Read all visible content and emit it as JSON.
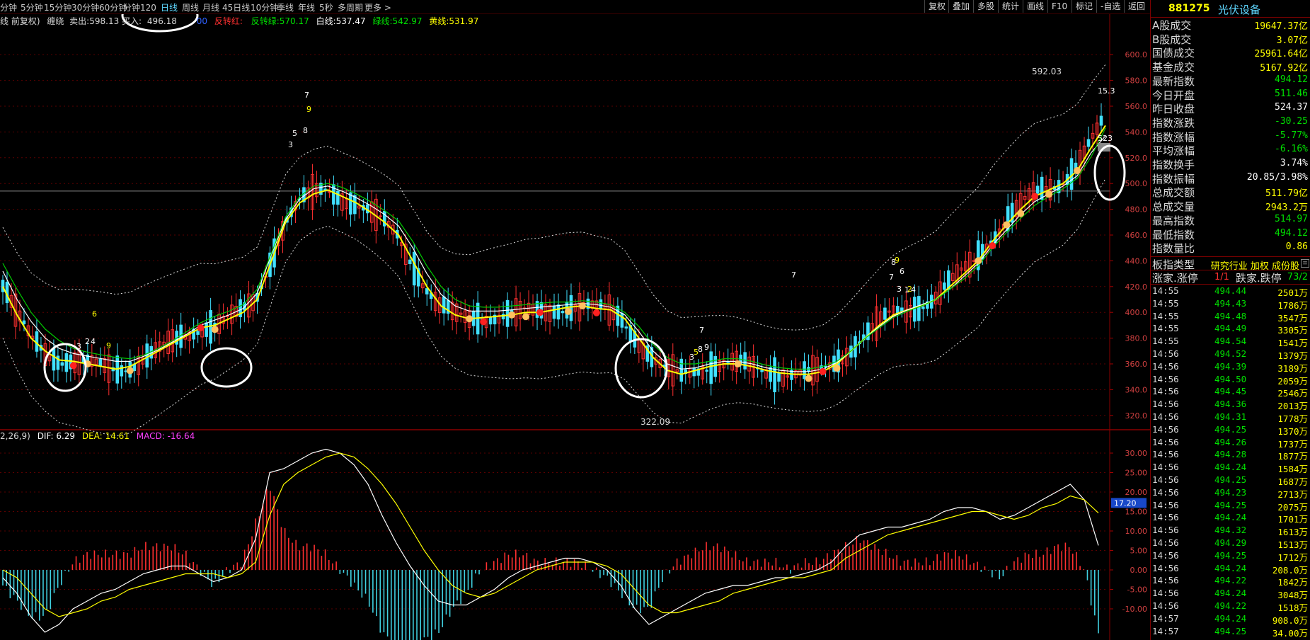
{
  "topbar": {
    "periods": [
      "分钟",
      "5分钟",
      "15分钟",
      "30分钟",
      "60分钟",
      "分钟120",
      "日线",
      "周线",
      "月线",
      "45日线",
      "10分钟",
      "季线",
      "年线",
      "5秒",
      "多周期",
      "更多 >"
    ],
    "active_period": "日线",
    "buttons": [
      "复权",
      "叠加",
      "多股",
      "统计",
      "画线",
      "F10",
      "标记",
      "-自选",
      "返回"
    ]
  },
  "legend": {
    "prefix": "线 前复权)",
    "item1": "缠绕",
    "sell_label": "卖出:",
    "sell_value": "598.13",
    "buy_label": "买入:",
    "buy_value": "496.18",
    "mid_value": "00",
    "red_label": "反转红:",
    "green_label": "反转绿:",
    "green_value": "570.17",
    "white_label": "白线:",
    "white_value": "537.47",
    "gline_label": "绿线:",
    "gline_value": "542.97",
    "yline_label": "黄线:",
    "yline_value": "531.97"
  },
  "macd_legend": {
    "params": "2,26,9)",
    "dif_label": "DIF:",
    "dif_value": "6.29",
    "dea_label": "DEA:",
    "dea_value": "14.61",
    "macd_label": "MACD:",
    "macd_value": "-16.64"
  },
  "annotations": {
    "high_label": "592.03",
    "low_label": "322.09",
    "current_tag": "523",
    "right_tag": "15.3",
    "macd_current": "17.20",
    "counts": [
      "7",
      "9",
      "3",
      "5",
      "8",
      "6",
      "2",
      "4",
      "3",
      "9",
      "7",
      "9",
      "3",
      "5",
      "8",
      "7",
      "8",
      "9",
      "6",
      "1",
      "3",
      "2",
      "4",
      "7"
    ]
  },
  "chart_data": [
    {
      "type": "line",
      "title": "",
      "ylim": [
        310,
        610
      ],
      "y_ticks": [
        "600.0",
        "580.0",
        "560.0",
        "540.0",
        "520.0",
        "500.0",
        "480.0",
        "460.0",
        "440.0",
        "420.0",
        "400.0",
        "380.0",
        "360.0",
        "340.0",
        "320.0"
      ],
      "series": [
        {
          "name": "黄线",
          "color": "#ffff00",
          "values": [
            420,
            398,
            380,
            370,
            363,
            362,
            360,
            358,
            356,
            358,
            364,
            370,
            376,
            382,
            388,
            390,
            395,
            400,
            410,
            440,
            470,
            485,
            492,
            495,
            490,
            485,
            478,
            470,
            460,
            440,
            420,
            405,
            398,
            395,
            396,
            397,
            398,
            400,
            400,
            402,
            404,
            405,
            403,
            402,
            395,
            380,
            365,
            355,
            352,
            355,
            358,
            360,
            360,
            358,
            355,
            353,
            352,
            352,
            354,
            360,
            370,
            380,
            390,
            398,
            402,
            405,
            410,
            420,
            430,
            440,
            455,
            468,
            480,
            490,
            495,
            500,
            510,
            528,
            545
          ]
        },
        {
          "name": "白线",
          "color": "#ffffff",
          "values": [
            432,
            410,
            393,
            380,
            372,
            368,
            366,
            364,
            362,
            362,
            366,
            371,
            377,
            383,
            390,
            394,
            398,
            403,
            415,
            445,
            472,
            488,
            496,
            498,
            494,
            489,
            483,
            476,
            467,
            450,
            430,
            414,
            405,
            401,
            401,
            401,
            402,
            403,
            404,
            405,
            406,
            407,
            406,
            404,
            398,
            385,
            370,
            360,
            356,
            357,
            360,
            362,
            362,
            360,
            357,
            355,
            354,
            354,
            356,
            361,
            370,
            380,
            389,
            397,
            402,
            406,
            410,
            418,
            428,
            438,
            452,
            464,
            476,
            486,
            492,
            498,
            506,
            524,
            537
          ]
        },
        {
          "name": "绿线",
          "color": "#00cc00",
          "values": [
            438,
            418,
            400,
            387,
            378,
            372,
            369,
            367,
            365,
            364,
            367,
            372,
            378,
            385,
            392,
            397,
            401,
            406,
            418,
            446,
            474,
            490,
            498,
            500,
            497,
            492,
            486,
            479,
            471,
            455,
            436,
            420,
            410,
            405,
            404,
            404,
            405,
            406,
            407,
            408,
            408,
            409,
            408,
            406,
            400,
            389,
            375,
            365,
            360,
            360,
            362,
            364,
            364,
            362,
            359,
            357,
            356,
            356,
            358,
            362,
            370,
            380,
            388,
            396,
            401,
            405,
            410,
            418,
            426,
            436,
            450,
            462,
            473,
            483,
            490,
            496,
            504,
            521,
            543
          ]
        }
      ],
      "price_range": {
        "high": 592.03,
        "low": 322.09
      }
    },
    {
      "type": "bar",
      "title": "MACD",
      "ylim": [
        -18,
        34
      ],
      "y_ticks": [
        "30.00",
        "25.00",
        "20.00",
        "15.00",
        "10.00",
        "5.00",
        "0.00",
        "-5.00",
        "-10.00"
      ],
      "series": [
        {
          "name": "DIF",
          "color": "#ffffff",
          "values": [
            -2,
            -6,
            -12,
            -16,
            -14,
            -10,
            -8,
            -6,
            -5,
            -3,
            -1,
            0,
            1,
            1,
            -1,
            -3,
            -2,
            0,
            8,
            25,
            26,
            28,
            30,
            31,
            30,
            27,
            22,
            14,
            7,
            1,
            -4,
            -8,
            -9,
            -9,
            -7,
            -5,
            -2,
            0,
            1,
            2,
            3,
            3,
            2,
            0,
            -4,
            -10,
            -14,
            -12,
            -10,
            -8,
            -6,
            -5,
            -4,
            -4,
            -3,
            -2,
            -2,
            -1,
            0,
            2,
            6,
            9,
            10,
            11,
            11,
            12,
            13,
            15,
            16,
            16,
            15,
            13,
            14,
            16,
            18,
            20,
            22,
            18,
            6.29
          ]
        },
        {
          "name": "DEA",
          "color": "#ffff00",
          "values": [
            0,
            -2,
            -6,
            -10,
            -12,
            -11,
            -10,
            -8,
            -7,
            -5,
            -4,
            -3,
            -2,
            -1,
            -1,
            -1,
            -2,
            -1,
            2,
            14,
            22,
            25,
            27,
            29,
            30,
            29,
            26,
            22,
            17,
            11,
            5,
            0,
            -4,
            -6,
            -7,
            -6,
            -4,
            -2,
            0,
            1,
            2,
            2,
            2,
            1,
            -1,
            -5,
            -9,
            -11,
            -11,
            -10,
            -9,
            -8,
            -6,
            -5,
            -4,
            -3,
            -2,
            -2,
            -1,
            0,
            3,
            5,
            7,
            9,
            10,
            11,
            12,
            13,
            14,
            15,
            15,
            14,
            13,
            14,
            16,
            17,
            19,
            18,
            14.61
          ]
        },
        {
          "name": "MACD",
          "color": "#ff3030",
          "values": [
            -4,
            -8,
            -12,
            -12,
            -4,
            2,
            4,
            4,
            4,
            4,
            6,
            6,
            6,
            4,
            0,
            -4,
            0,
            2,
            12,
            22,
            10,
            6,
            6,
            4,
            0,
            -4,
            -8,
            -16,
            -20,
            -20,
            -18,
            -16,
            -10,
            -6,
            0,
            2,
            4,
            4,
            2,
            2,
            2,
            2,
            0,
            -2,
            -6,
            -10,
            -10,
            -2,
            2,
            4,
            6,
            6,
            4,
            2,
            2,
            2,
            0,
            2,
            2,
            4,
            6,
            8,
            6,
            4,
            2,
            2,
            2,
            4,
            4,
            2,
            0,
            -2,
            2,
            4,
            4,
            6,
            6,
            0,
            -16.64
          ]
        }
      ]
    }
  ],
  "side": {
    "code": "881275",
    "name": "光伏设备",
    "rows": [
      {
        "label": "A股成交",
        "value": "19647.37亿",
        "color": "#ffff00"
      },
      {
        "label": "B股成交",
        "value": "3.07亿",
        "color": "#ffff00"
      },
      {
        "label": "国债成交",
        "value": "25961.64亿",
        "color": "#ffff00"
      },
      {
        "label": "基金成交",
        "value": "5167.92亿",
        "color": "#ffff00"
      },
      {
        "label": "最新指数",
        "value": "494.12",
        "color": "#00e000"
      },
      {
        "label": "今日开盘",
        "value": "511.46",
        "color": "#00e000"
      },
      {
        "label": "昨日收盘",
        "value": "524.37",
        "color": "#ffffff"
      },
      {
        "label": "指数涨跌",
        "value": "-30.25",
        "color": "#00e000"
      },
      {
        "label": "指数涨幅",
        "value": "-5.77%",
        "color": "#00e000"
      },
      {
        "label": "平均涨幅",
        "value": "-6.16%",
        "color": "#00e000"
      },
      {
        "label": "指数换手",
        "value": "3.74%",
        "color": "#ffffff"
      },
      {
        "label": "指数振幅",
        "value": "20.85/3.98%",
        "color": "#ffffff"
      },
      {
        "label": "总成交额",
        "value": "511.79亿",
        "color": "#ffff00"
      },
      {
        "label": "总成交量",
        "value": "2943.2万",
        "color": "#ffff00"
      },
      {
        "label": "最高指数",
        "value": "514.97",
        "color": "#00e000"
      },
      {
        "label": "最低指数",
        "value": "494.12",
        "color": "#00e000"
      },
      {
        "label": "指数量比",
        "value": "0.86",
        "color": "#ffff00"
      }
    ],
    "type_label": "板指类型",
    "type_value": "研究行业 加权 成份股",
    "up_label": "涨家.涨停",
    "up_value": "1/1",
    "down_label": "跌家.跌停",
    "down_value": "73/2",
    "ticks": [
      {
        "time": "14:55",
        "price": "494.44",
        "vol": "2501万"
      },
      {
        "time": "14:55",
        "price": "494.43",
        "vol": "1786万"
      },
      {
        "time": "14:55",
        "price": "494.48",
        "vol": "3547万"
      },
      {
        "time": "14:55",
        "price": "494.49",
        "vol": "3305万"
      },
      {
        "time": "14:55",
        "price": "494.54",
        "vol": "1541万"
      },
      {
        "time": "14:56",
        "price": "494.52",
        "vol": "1379万"
      },
      {
        "time": "14:56",
        "price": "494.39",
        "vol": "3189万"
      },
      {
        "time": "14:56",
        "price": "494.50",
        "vol": "2059万"
      },
      {
        "time": "14:56",
        "price": "494.45",
        "vol": "2546万"
      },
      {
        "time": "14:56",
        "price": "494.36",
        "vol": "2013万"
      },
      {
        "time": "14:56",
        "price": "494.31",
        "vol": "1778万"
      },
      {
        "time": "14:56",
        "price": "494.25",
        "vol": "1370万"
      },
      {
        "time": "14:56",
        "price": "494.26",
        "vol": "1737万"
      },
      {
        "time": "14:56",
        "price": "494.28",
        "vol": "1877万"
      },
      {
        "time": "14:56",
        "price": "494.24",
        "vol": "1584万"
      },
      {
        "time": "14:56",
        "price": "494.25",
        "vol": "1687万"
      },
      {
        "time": "14:56",
        "price": "494.23",
        "vol": "2713万"
      },
      {
        "time": "14:56",
        "price": "494.25",
        "vol": "2075万"
      },
      {
        "time": "14:56",
        "price": "494.24",
        "vol": "1701万"
      },
      {
        "time": "14:56",
        "price": "494.32",
        "vol": "1613万"
      },
      {
        "time": "14:56",
        "price": "494.29",
        "vol": "1513万"
      },
      {
        "time": "14:56",
        "price": "494.25",
        "vol": "1712万"
      },
      {
        "time": "14:56",
        "price": "494.24",
        "vol": "208.0万"
      },
      {
        "time": "14:56",
        "price": "494.22",
        "vol": "1842万"
      },
      {
        "time": "14:56",
        "price": "494.24",
        "vol": "3048万"
      },
      {
        "time": "14:56",
        "price": "494.22",
        "vol": "1518万"
      },
      {
        "time": "14:57",
        "price": "494.24",
        "vol": "908.0万"
      },
      {
        "time": "14:57",
        "price": "494.25",
        "vol": "34.00万"
      }
    ]
  }
}
